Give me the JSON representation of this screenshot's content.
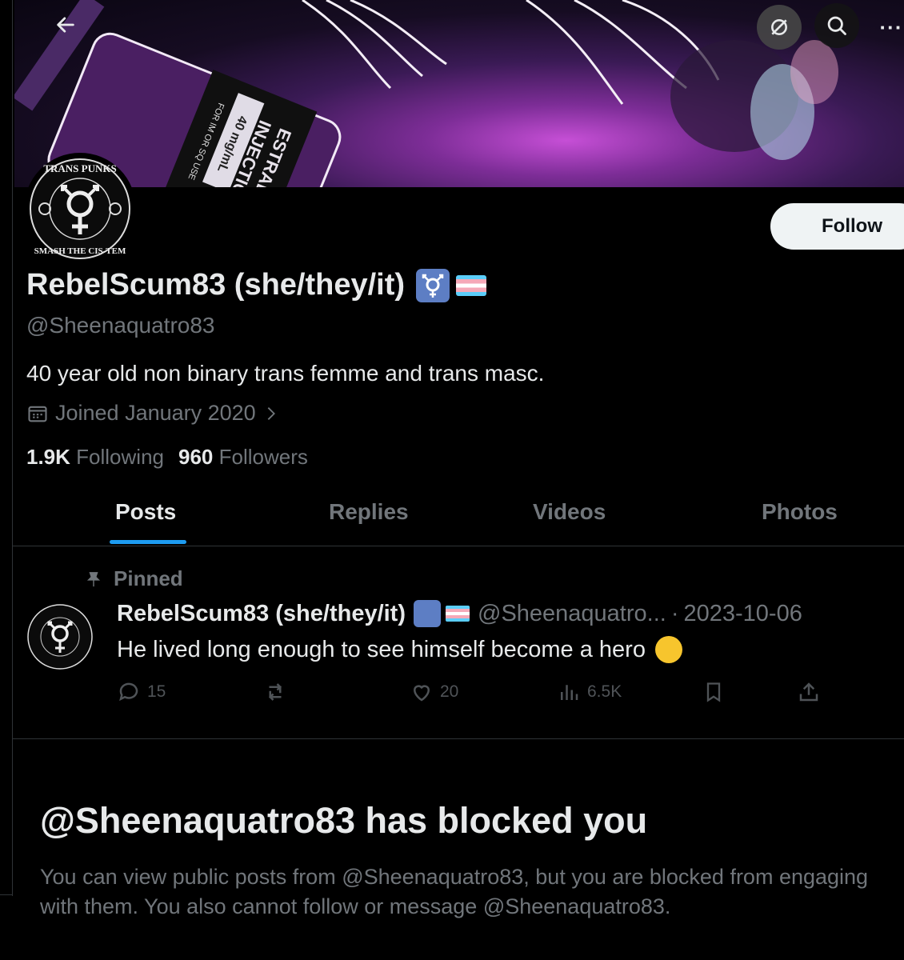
{
  "banner": {
    "vial_label_1": "ESTRADIOL",
    "vial_label_2": "INJECTION",
    "vial_dose": "40 mg/mL",
    "vial_route": "FOR IM OR SQ USE"
  },
  "nav": {
    "back_icon": "arrow-left-icon",
    "mute_icon": "muted-icon",
    "search_icon": "search-icon",
    "more_icon": "more-icon",
    "more_glyph": "···"
  },
  "profile": {
    "avatar_text_top": "TRANS PUNKS",
    "avatar_text_bottom": "SMASH THE CIS-TEM",
    "follow_label": "Follow",
    "display_name": "RebelScum83 (she/they/it)",
    "handle": "@Sheenaquatro83",
    "bio": "40 year old non binary trans femme and trans masc.",
    "joined": "Joined January 2020",
    "following_count": "1.9K",
    "following_label": "Following",
    "followers_count": "960",
    "followers_label": "Followers"
  },
  "tabs": [
    {
      "label": "Posts",
      "active": true
    },
    {
      "label": "Replies",
      "active": false
    },
    {
      "label": "Videos",
      "active": false
    },
    {
      "label": "Photos",
      "active": false
    }
  ],
  "pinned_tweet": {
    "pinned_label": "Pinned",
    "author_name": "RebelScum83 (she/they/it)",
    "author_handle": "@Sheenaquatro...",
    "separator": "·",
    "date": "2023-10-06",
    "text": "He lived long enough to see himself become a hero",
    "replies": "15",
    "reposts": "",
    "likes": "20",
    "views": "6.5K"
  },
  "blocked": {
    "title": "@Sheenaquatro83 has blocked you",
    "message": "You can view public posts from @Sheenaquatro83, but you are blocked from engaging with them. You also cannot follow or message @Sheenaquatro83."
  },
  "colors": {
    "background": "#000000",
    "text_primary": "#e7e9ea",
    "text_secondary": "#71767b",
    "accent": "#1d9bf0",
    "follow_bg": "#eff3f4"
  }
}
